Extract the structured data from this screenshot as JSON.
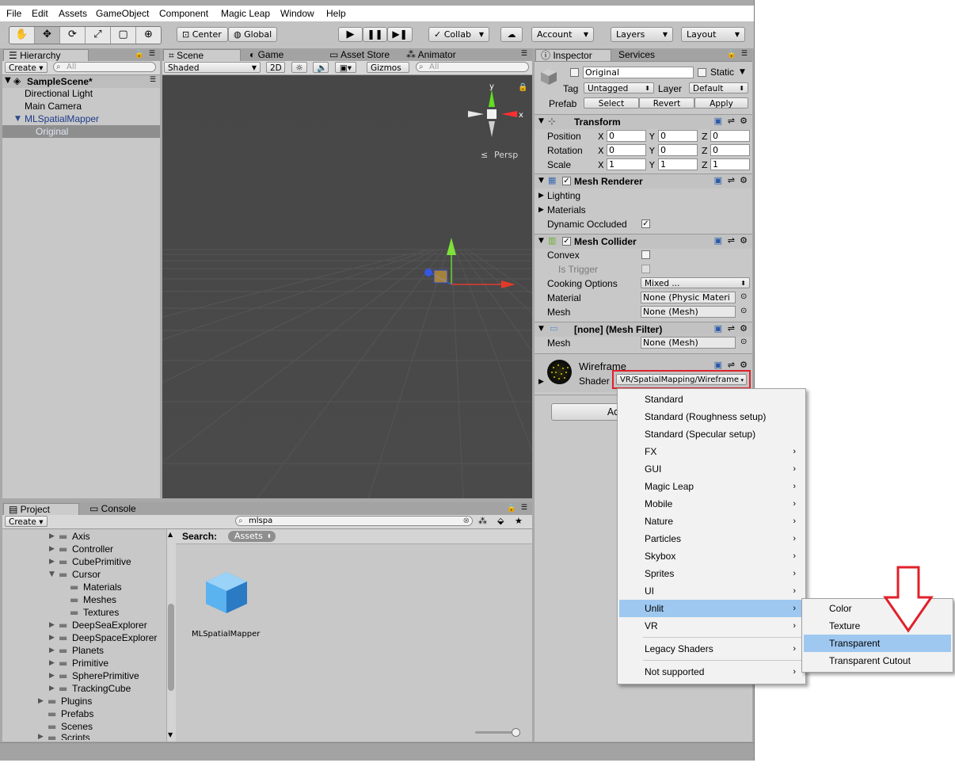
{
  "menubar": [
    "File",
    "Edit",
    "Assets",
    "GameObject",
    "Component",
    "Magic Leap",
    "Window",
    "Help"
  ],
  "toolbar": {
    "center": "Center",
    "global": "Global",
    "collab": "Collab",
    "account": "Account",
    "layers": "Layers",
    "layout": "Layout"
  },
  "hierarchy": {
    "tab": "Hierarchy",
    "create": "Create",
    "search_placeholder": "All",
    "scene": "SampleScene*",
    "items": [
      "Directional Light",
      "Main Camera",
      "MLSpatialMapper",
      "Original"
    ]
  },
  "scene": {
    "tabs": [
      "Scene",
      "Game",
      "Asset Store",
      "Animator"
    ],
    "shading": "Shaded",
    "mode2d": "2D",
    "gizmos": "Gizmos",
    "search_placeholder": "All",
    "persp": "Persp",
    "gizmo_y": "y",
    "gizmo_x": "x"
  },
  "inspector": {
    "tabs": [
      "Inspector",
      "Services"
    ],
    "name": "Original",
    "static": "Static",
    "tag_label": "Tag",
    "tag_value": "Untagged",
    "layer_label": "Layer",
    "layer_value": "Default",
    "prefab_label": "Prefab",
    "prefab_buttons": [
      "Select",
      "Revert",
      "Apply"
    ],
    "transform": {
      "title": "Transform",
      "rows": [
        {
          "label": "Position",
          "x": "0",
          "y": "0",
          "z": "0"
        },
        {
          "label": "Rotation",
          "x": "0",
          "y": "0",
          "z": "0"
        },
        {
          "label": "Scale",
          "x": "1",
          "y": "1",
          "z": "1"
        }
      ],
      "axes": [
        "X",
        "Y",
        "Z"
      ]
    },
    "mesh_renderer": {
      "title": "Mesh Renderer",
      "lighting": "Lighting",
      "materials": "Materials",
      "dynamic_occluded": "Dynamic Occluded"
    },
    "mesh_collider": {
      "title": "Mesh Collider",
      "convex": "Convex",
      "is_trigger": "Is Trigger",
      "cooking_options": "Cooking Options",
      "cooking_value": "Mixed ...",
      "material": "Material",
      "material_value": "None (Physic Materi",
      "mesh": "Mesh",
      "mesh_value": "None (Mesh)"
    },
    "mesh_filter": {
      "title": "[none] (Mesh Filter)",
      "mesh": "Mesh",
      "mesh_value": "None (Mesh)"
    },
    "material": {
      "title": "Wireframe",
      "shader_label": "Shader",
      "shader_value": "VR/SpatialMapping/Wireframe"
    },
    "add_component": "Add"
  },
  "project": {
    "tabs": [
      "Project",
      "Console"
    ],
    "create": "Create",
    "search_value": "mlspa",
    "search_label": "Search:",
    "search_scope": "Assets",
    "tree": [
      "Axis",
      "Controller",
      "CubePrimitive",
      "Cursor",
      "Materials",
      "Meshes",
      "Textures",
      "DeepSeaExplorer",
      "DeepSpaceExplorer",
      "Planets",
      "Primitive",
      "SpherePrimitive",
      "TrackingCube",
      "Plugins",
      "Prefabs",
      "Scenes",
      "Scripts"
    ],
    "asset_name": "MLSpatialMapper"
  },
  "shader_menu": {
    "items": [
      "Standard",
      "Standard (Roughness setup)",
      "Standard (Specular setup)",
      "FX",
      "GUI",
      "Magic Leap",
      "Mobile",
      "Nature",
      "Particles",
      "Skybox",
      "Sprites",
      "UI",
      "Unlit",
      "VR",
      "Legacy Shaders",
      "Not supported"
    ],
    "highlighted": "Unlit"
  },
  "unlit_submenu": {
    "items": [
      "Color",
      "Texture",
      "Transparent",
      "Transparent Cutout"
    ],
    "highlighted": "Transparent"
  },
  "colors": {
    "highlight_red": "#e0202a",
    "menu_highlight": "#9ec8f0",
    "selection_blue": "#3e5f96",
    "scene_bg": "#474747"
  }
}
